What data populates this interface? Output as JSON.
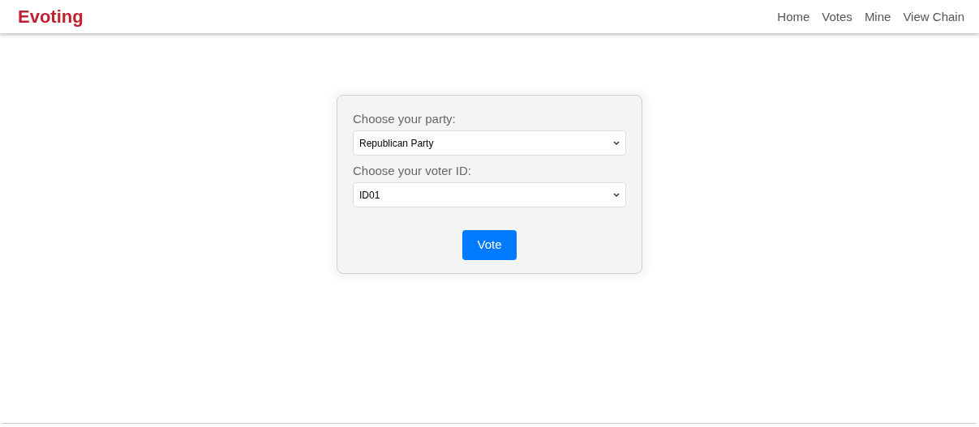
{
  "brand": "Evoting",
  "nav": [
    "Home",
    "Votes",
    "Mine",
    "View Chain"
  ],
  "form": {
    "fields": [
      {
        "label": "Choose your party:",
        "value": "Republican Party"
      },
      {
        "label": "Choose your voter ID:",
        "value": "ID01"
      }
    ],
    "button": "Vote"
  }
}
